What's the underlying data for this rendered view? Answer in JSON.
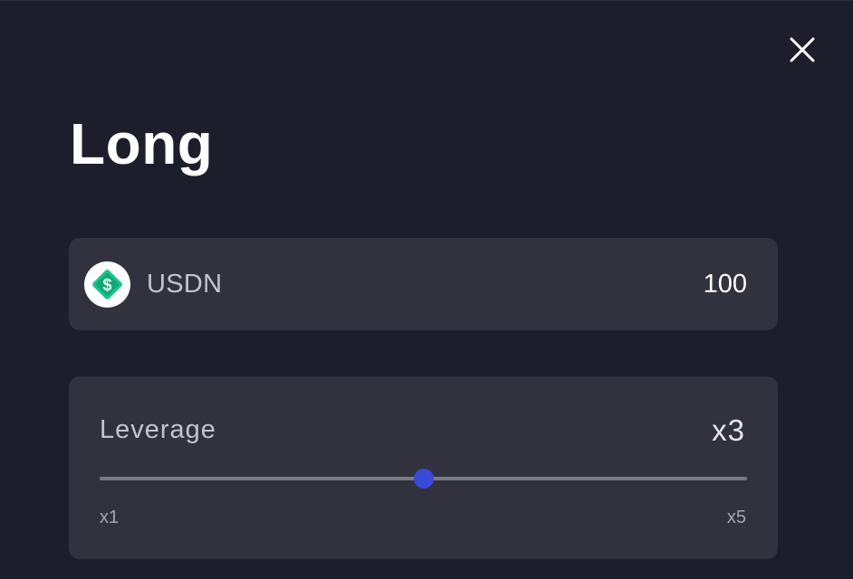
{
  "modal": {
    "title": "Long",
    "close_icon": "close-icon"
  },
  "amount": {
    "token_icon": "usdn-token-icon",
    "token_name": "USDN",
    "value": "100"
  },
  "leverage": {
    "label": "Leverage",
    "value": "x3",
    "min_label": "x1",
    "max_label": "x5",
    "min": 1,
    "max": 5,
    "current": 3,
    "accent_color": "#3949d8"
  },
  "colors": {
    "background": "#1d1e2c",
    "card": "#32323f",
    "token_green": "#1fc58a"
  }
}
